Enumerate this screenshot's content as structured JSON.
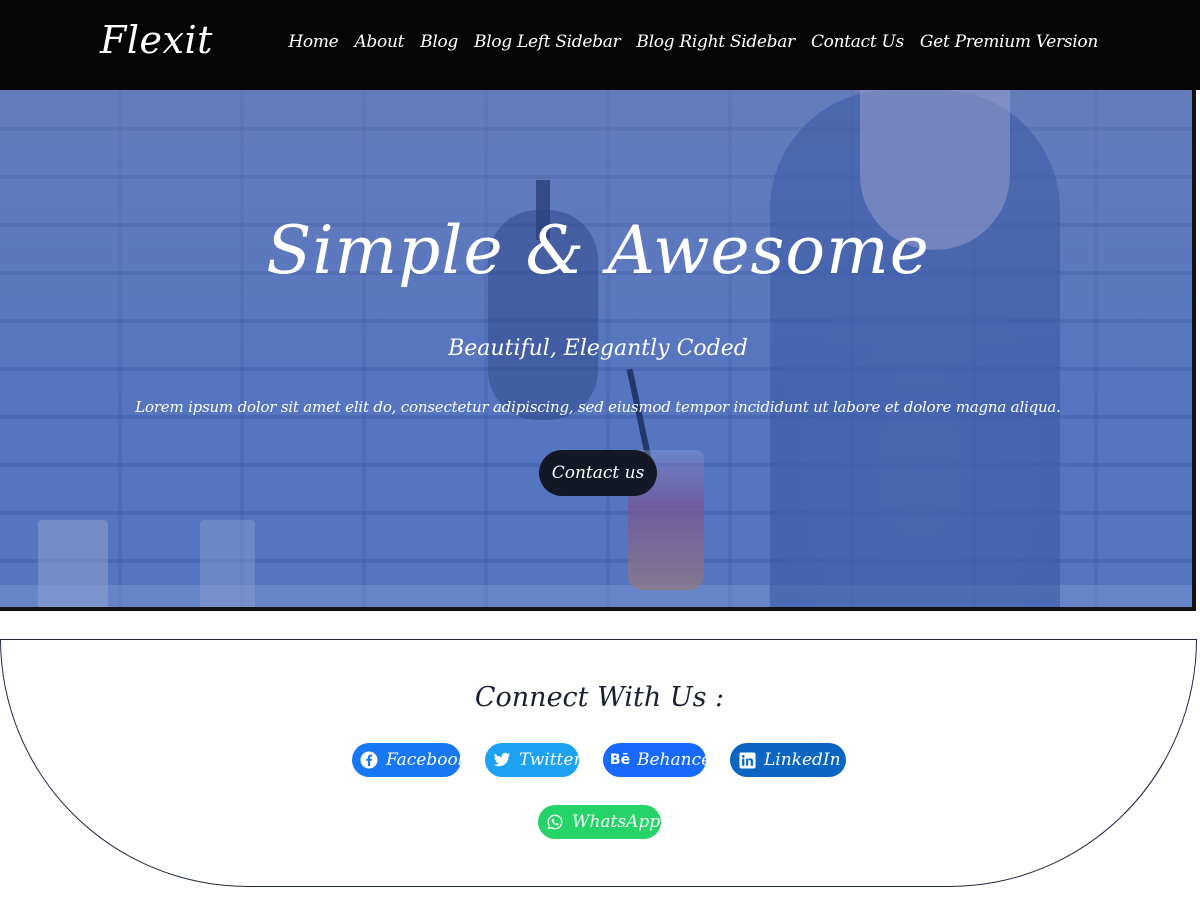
{
  "brand": "Flexit",
  "nav": {
    "items": [
      {
        "label": "Home"
      },
      {
        "label": "About"
      },
      {
        "label": "Blog"
      },
      {
        "label": "Blog Left Sidebar"
      },
      {
        "label": "Blog Right Sidebar"
      },
      {
        "label": "Contact Us"
      },
      {
        "label": "Get Premium Version"
      }
    ]
  },
  "hero": {
    "title": "Simple & Awesome",
    "subtitle": "Beautiful, Elegantly Coded",
    "text": "Lorem ipsum dolor sit amet elit do, consectetur adipiscing, sed eiusmod tempor incididunt ut labore et dolore magna aliqua.",
    "button_label": "Contact us",
    "overlay_color": "#3462c4"
  },
  "connect": {
    "title": "Connect With Us :",
    "links": [
      {
        "label": "Facebook",
        "icon": "facebook-icon",
        "color": "#1877f2"
      },
      {
        "label": "Twitter",
        "icon": "twitter-icon",
        "color": "#1da1f2"
      },
      {
        "label": "Behance",
        "icon": "behance-icon",
        "color": "#1769ff"
      },
      {
        "label": "LinkedIn",
        "icon": "linkedin-icon",
        "color": "#0a66c2"
      },
      {
        "label": "WhatsApp",
        "icon": "whatsapp-icon",
        "color": "#25d366"
      }
    ]
  }
}
